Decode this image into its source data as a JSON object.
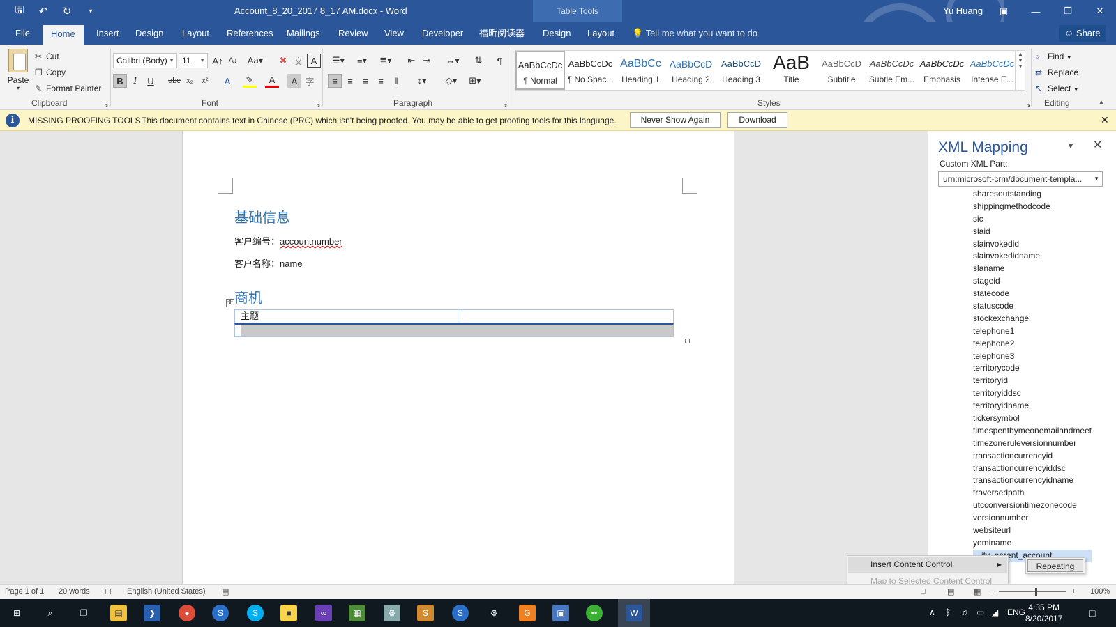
{
  "window": {
    "title": "Account_8_20_2017 8_17 AM.docx  -  Word",
    "contextual_header": "Table Tools",
    "user": "Yu Huang"
  },
  "tabs": [
    "File",
    "Home",
    "Insert",
    "Design",
    "Layout",
    "References",
    "Mailings",
    "Review",
    "View",
    "Developer",
    "福昕阅读器",
    "Design",
    "Layout"
  ],
  "active_tab": "Home",
  "tell_me": "Tell me what you want to do",
  "share": "Share",
  "ribbon": {
    "clipboard": {
      "paste": "Paste",
      "cut": "Cut",
      "copy": "Copy",
      "format_painter": "Format Painter",
      "label": "Clipboard"
    },
    "font": {
      "name": "Calibri (Body)",
      "size": "11",
      "label": "Font"
    },
    "paragraph": {
      "label": "Paragraph"
    },
    "styles": {
      "label": "Styles",
      "items": [
        {
          "preview": "AaBbCcDc",
          "name": "¶ Normal"
        },
        {
          "preview": "AaBbCcDc",
          "name": "¶ No Spac..."
        },
        {
          "preview": "AaBbCc",
          "name": "Heading 1"
        },
        {
          "preview": "AaBbCcD",
          "name": "Heading 2"
        },
        {
          "preview": "AaBbCcD",
          "name": "Heading 3"
        },
        {
          "preview": "AaB",
          "name": "Title"
        },
        {
          "preview": "AaBbCcD",
          "name": "Subtitle"
        },
        {
          "preview": "AaBbCcDc",
          "name": "Subtle Em..."
        },
        {
          "preview": "AaBbCcDc",
          "name": "Emphasis"
        },
        {
          "preview": "AaBbCcDc",
          "name": "Intense E..."
        }
      ]
    },
    "editing": {
      "find": "Find",
      "replace": "Replace",
      "select": "Select",
      "label": "Editing"
    }
  },
  "infobar": {
    "title": "MISSING PROOFING TOOLS",
    "message": "This document contains text in Chinese (PRC) which isn't being proofed. You may be able to get proofing tools for this language.",
    "never_show": "Never Show Again",
    "download": "Download"
  },
  "document": {
    "heading1": "基础信息",
    "line1_label": "客户编号：",
    "line1_value": "accountnumber",
    "line2_label": "客户名称：",
    "line2_value": "name",
    "heading2": "商机",
    "table_header": "主题"
  },
  "xml_pane": {
    "title": "XML Mapping",
    "custom_part_label": "Custom XML Part:",
    "custom_part_value": "urn:microsoft-crm/document-templa...",
    "nodes": [
      "sharesoutstanding",
      "shippingmethodcode",
      "sic",
      "slaid",
      "slainvokedid",
      "slainvokedidname",
      "slaname",
      "stageid",
      "statecode",
      "statuscode",
      "stockexchange",
      "telephone1",
      "telephone2",
      "telephone3",
      "territorycode",
      "territoryid",
      "territoryiddsc",
      "territoryidname",
      "tickersymbol",
      "timespentbymeonemailandmeet",
      "timezoneruleversionnumber",
      "transactioncurrencyid",
      "transactioncurrencyiddsc",
      "transactioncurrencyidname",
      "traversedpath",
      "utcconversiontimezonecode",
      "versionnumber",
      "websiteurl",
      "yominame"
    ],
    "highlighted_node": "...ity_parent_account"
  },
  "context_menu": {
    "insert_content_control": "Insert Content Control",
    "map_to_selected": "Map to Selected Content Control",
    "submenu_repeating": "Repeating"
  },
  "statusbar": {
    "page": "Page 1 of 1",
    "words": "20 words",
    "language": "English (United States)",
    "zoom": "100%"
  },
  "taskbar": {
    "lang": "ENG",
    "time": "4:35 PM",
    "date": "8/20/2017"
  }
}
